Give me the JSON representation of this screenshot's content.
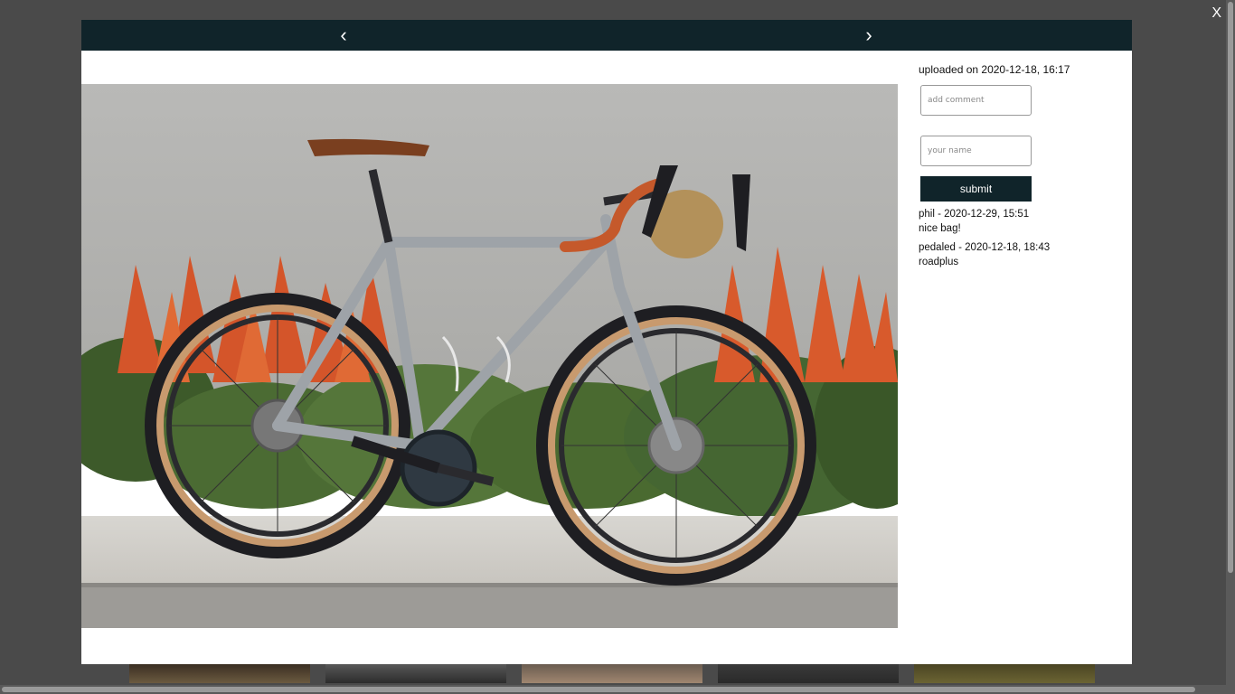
{
  "overlay": {
    "close_label": "X"
  },
  "gallery": {
    "prev_label": "‹",
    "next_label": "›",
    "image_alt": "bicycle-photo"
  },
  "sidebar": {
    "uploaded": "uploaded on 2020-12-18, 16:17",
    "comment_placeholder": "add comment",
    "name_placeholder": "your name",
    "submit_label": "submit"
  },
  "comments": [
    {
      "meta": "phil - 2020-12-29, 15:51",
      "text": "nice bag!"
    },
    {
      "meta": "pedaled - 2020-12-18, 18:43",
      "text": "roadplus"
    }
  ],
  "colors": {
    "bar": "#10242a",
    "backdrop": "#4a4a4a",
    "tire_skin": "#c89a6e"
  },
  "icons": [
    "chevron-left-icon",
    "chevron-right-icon",
    "close-icon"
  ]
}
